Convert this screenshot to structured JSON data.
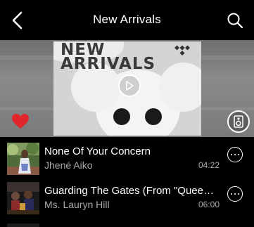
{
  "header": {
    "title": "New Arrivals",
    "back_icon": "chevron-left-icon",
    "search_icon": "search-icon"
  },
  "hero": {
    "art_line1": "NEW",
    "art_line2": "ARRIVALS",
    "play_icon": "play-icon",
    "heart_icon": "heart-icon",
    "speaker_icon": "speaker-icon",
    "heart_color": "#e0252b"
  },
  "tracks": [
    {
      "title": "None Of Your Concern",
      "artist": "Jhené Aiko",
      "duration": "04:22",
      "more_icon": "more-options-icon"
    },
    {
      "title": "Guarding The Gates (From \"Queen…",
      "artist": "Ms. Lauryn Hill",
      "duration": "06:00",
      "more_icon": "more-options-icon"
    }
  ],
  "colors": {
    "background": "#000000",
    "secondary_text": "#a8a8a8",
    "accent_heart": "#e0252b"
  }
}
